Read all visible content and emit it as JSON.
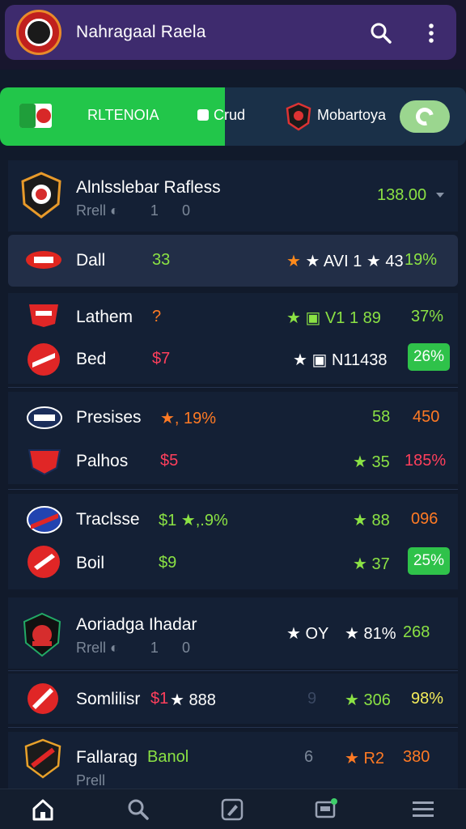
{
  "header": {
    "title": "Nahragaal  Raela"
  },
  "tabs": [
    {
      "label": "RLTENOIA"
    },
    {
      "label": "Crud"
    },
    {
      "label": "Mobartoya"
    }
  ],
  "league1": {
    "title": "Alnlsslebar Rafless",
    "sub_a": "Rrell",
    "sub_b": "1",
    "sub_c": "0",
    "odds": "138.00"
  },
  "rows": [
    {
      "name": "Dall",
      "v1": "33",
      "mid": "★ AVI 1 ★ 43",
      "pct": "19%"
    },
    {
      "name": "Lathem",
      "v1": "?",
      "mid": "★ ▣ V1 1  89",
      "pct": "37%"
    },
    {
      "name": "Bed",
      "v1": "$7",
      "mid": "★ ▣ N11438",
      "pct": "26%"
    },
    {
      "name": "Presises",
      "v1": "★, 19%",
      "right1": "58",
      "right2": "450"
    },
    {
      "name": "Palhos",
      "v1": "$5",
      "right1": "★ 35",
      "right2": "185%"
    },
    {
      "name": "Traclsse",
      "v1": "$1 ★,.9%",
      "right1": "★ 88",
      "right2": "096"
    },
    {
      "name": "Boil",
      "v1": "$9",
      "right1": "★ 37",
      "pct": "25%"
    }
  ],
  "league2": {
    "title": "Aoriadga Ihadar",
    "sub_a": "Rrell",
    "sub_b": "1",
    "sub_c": "0",
    "right1": "★ OY",
    "right2": "★ 81%",
    "right3": "268"
  },
  "row8": {
    "name": "Somlilisr",
    "v1": "$1",
    "v2": "★ 888",
    "mid": "9",
    "right1": "★ 306",
    "right2": "98%"
  },
  "row9": {
    "name": "Fallarag",
    "name2": "Banol",
    "sub": "Prell",
    "mid": "6",
    "right1": "★ R2",
    "right2": "380"
  },
  "nav": [
    "home-icon",
    "search-icon",
    "edit-icon",
    "scoreboard-icon",
    "menu-icon"
  ]
}
